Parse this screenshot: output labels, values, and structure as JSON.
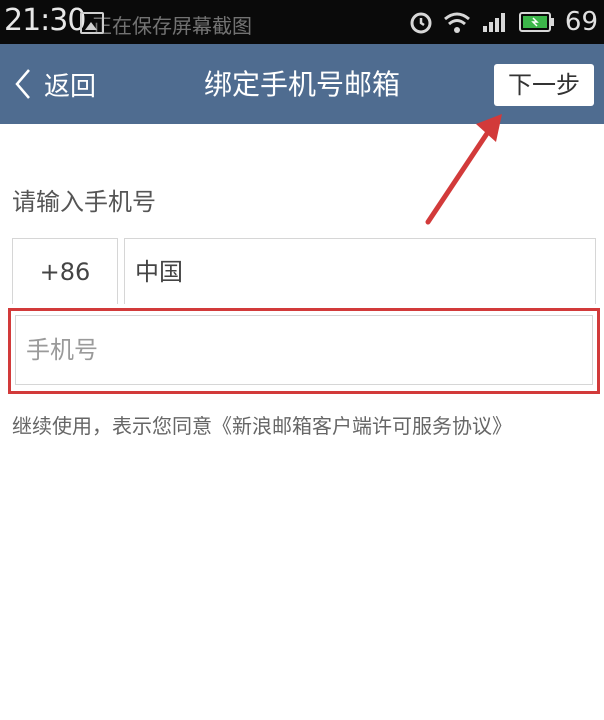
{
  "status_bar": {
    "time": "21:30",
    "notification_text": "正在保存屏幕截图",
    "battery_level": "69",
    "icons": [
      "alarm-icon",
      "wifi-icon",
      "signal-icon",
      "battery-icon"
    ]
  },
  "header": {
    "back_label": "返回",
    "title": "绑定手机号邮箱",
    "next_label": "下一步",
    "bg_color": "#4f6c90"
  },
  "form": {
    "section_label": "请输入手机号",
    "country_code": "+86",
    "country_name": "中国",
    "phone_placeholder": "手机号",
    "phone_value": "",
    "agreement_text": "继续使用，表示您同意《新浪邮箱客户端许可服务协议》"
  },
  "annotation": {
    "highlight_color": "#d23a3a"
  }
}
